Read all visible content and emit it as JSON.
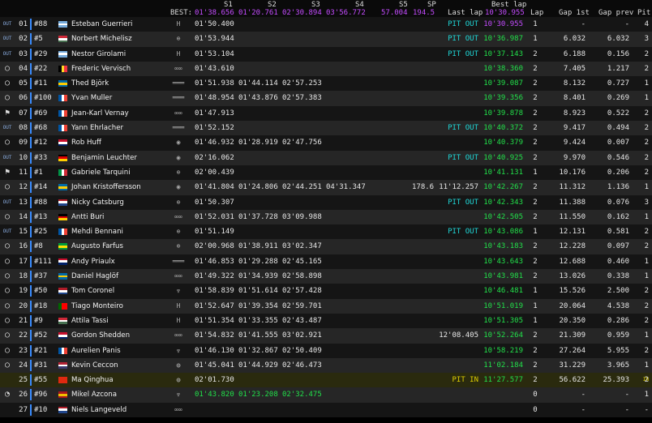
{
  "header": {
    "best_label": "BEST:",
    "s1": "S1",
    "s2": "S2",
    "s3": "S3",
    "s4": "S4",
    "s5": "S5",
    "sp": "SP",
    "best_s1": "01'38.656",
    "best_s2": "01'20.761",
    "best_s3": "02'30.894",
    "best_s4": "03'56.772",
    "best_s5": "57.004",
    "best_sp": "194.5",
    "last_lap": "Last lap",
    "best_lap": "Best lap",
    "best_lap_value": "10'30.955",
    "lap": "Lap",
    "gap1": "Gap 1st",
    "gapprev": "Gap prev",
    "pit": "Pit"
  },
  "colors": {
    "green": "#22e04a",
    "purple": "#c44cff",
    "pitout": "#1fd6d6",
    "pitin": "#e0d000",
    "bar": "#3a8cff"
  },
  "rows": [
    {
      "status": "OUT",
      "pos": "01",
      "num": "#88",
      "flag": "argentina",
      "name": "Esteban Guerrieri",
      "logo": "honda",
      "s1": "01'50.400",
      "s2": "",
      "s3": "",
      "s4": "",
      "s5": "",
      "sp": "",
      "last": "PIT OUT",
      "best": "10'30.955",
      "best_color": "purple",
      "lap": "1",
      "gap1": "-",
      "gapprev": "-",
      "pit": "4"
    },
    {
      "status": "OUT",
      "pos": "02",
      "num": "#5",
      "flag": "hungary",
      "name": "Norbert Michelisz",
      "logo": "hyundai",
      "s1": "01'53.944",
      "s2": "",
      "s3": "",
      "s4": "",
      "s5": "",
      "sp": "",
      "last": "PIT OUT",
      "best": "10'36.987",
      "best_color": "green",
      "lap": "1",
      "gap1": "6.032",
      "gapprev": "6.032",
      "pit": "3"
    },
    {
      "status": "OUT",
      "pos": "03",
      "num": "#29",
      "flag": "argentina",
      "name": "Nestor Girolami",
      "logo": "honda",
      "s1": "01'53.104",
      "s2": "",
      "s3": "",
      "s4": "",
      "s5": "",
      "sp": "",
      "last": "PIT OUT",
      "best": "10'37.143",
      "best_color": "green",
      "lap": "2",
      "gap1": "6.188",
      "gapprev": "0.156",
      "pit": "2"
    },
    {
      "status": "ring",
      "pos": "04",
      "num": "#22",
      "flag": "belgium",
      "name": "Frederic Vervisch",
      "logo": "audi",
      "s1": "01'43.610",
      "s2": "",
      "s3": "",
      "s4": "",
      "s5": "",
      "sp": "",
      "last": "",
      "best": "10'38.360",
      "best_color": "green",
      "lap": "2",
      "gap1": "7.405",
      "gapprev": "1.217",
      "pit": "2"
    },
    {
      "status": "ring",
      "pos": "05",
      "num": "#11",
      "flag": "sweden",
      "name": "Thed Björk",
      "logo": "lynk",
      "s1": "01'51.938",
      "s2": "01'44.114",
      "s3": "02'57.253",
      "s4": "",
      "s5": "",
      "sp": "",
      "last": "",
      "best": "10'39.087",
      "best_color": "green",
      "lap": "2",
      "gap1": "8.132",
      "gapprev": "0.727",
      "pit": "1"
    },
    {
      "status": "ring",
      "pos": "06",
      "num": "#100",
      "flag": "france",
      "name": "Yvan Muller",
      "logo": "lynk",
      "s1": "01'48.954",
      "s2": "01'43.876",
      "s3": "02'57.383",
      "s4": "",
      "s5": "",
      "sp": "",
      "last": "",
      "best": "10'39.356",
      "best_color": "green",
      "lap": "2",
      "gap1": "8.401",
      "gapprev": "0.269",
      "pit": "1"
    },
    {
      "status": "flag",
      "pos": "07",
      "num": "#69",
      "flag": "france",
      "name": "Jean-Karl Vernay",
      "logo": "audi",
      "s1": "01'47.913",
      "s2": "",
      "s3": "",
      "s4": "",
      "s5": "",
      "sp": "",
      "last": "",
      "best": "10'39.878",
      "best_color": "green",
      "lap": "2",
      "gap1": "8.923",
      "gapprev": "0.522",
      "pit": "2"
    },
    {
      "status": "OUT",
      "pos": "08",
      "num": "#68",
      "flag": "france",
      "name": "Yann Ehrlacher",
      "logo": "lynk",
      "s1": "01'52.152",
      "s2": "",
      "s3": "",
      "s4": "",
      "s5": "",
      "sp": "",
      "last": "PIT OUT",
      "best": "10'40.372",
      "best_color": "green",
      "lap": "2",
      "gap1": "9.417",
      "gapprev": "0.494",
      "pit": "2"
    },
    {
      "status": "ring",
      "pos": "09",
      "num": "#12",
      "flag": "uk",
      "name": "Rob Huff",
      "logo": "vw",
      "s1": "01'46.932",
      "s2": "01'28.919",
      "s3": "02'47.756",
      "s4": "",
      "s5": "",
      "sp": "",
      "last": "",
      "best": "10'40.379",
      "best_color": "green",
      "lap": "2",
      "gap1": "9.424",
      "gapprev": "0.007",
      "pit": "2"
    },
    {
      "status": "OUT",
      "pos": "10",
      "num": "#33",
      "flag": "germany",
      "name": "Benjamin Leuchter",
      "logo": "vw",
      "s1": "02'16.062",
      "s2": "",
      "s3": "",
      "s4": "",
      "s5": "",
      "sp": "",
      "last": "PIT OUT",
      "best": "10'40.925",
      "best_color": "green",
      "lap": "2",
      "gap1": "9.970",
      "gapprev": "0.546",
      "pit": "2"
    },
    {
      "status": "flag",
      "pos": "11",
      "num": "#1",
      "flag": "italy",
      "name": "Gabriele Tarquini",
      "logo": "hyundai",
      "s1": "02'00.439",
      "s2": "",
      "s3": "",
      "s4": "",
      "s5": "",
      "sp": "",
      "last": "",
      "best": "10'41.131",
      "best_color": "green",
      "lap": "1",
      "gap1": "10.176",
      "gapprev": "0.206",
      "pit": "2"
    },
    {
      "status": "ring",
      "pos": "12",
      "num": "#14",
      "flag": "sweden",
      "name": "Johan Kristoffersson",
      "logo": "vw",
      "s1": "01'41.804",
      "s2": "01'24.806",
      "s3": "02'44.251",
      "s4": "04'31.347",
      "s5": "",
      "sp": "178.6",
      "last": "11'12.257",
      "best": "10'42.267",
      "best_color": "green",
      "lap": "2",
      "gap1": "11.312",
      "gapprev": "1.136",
      "pit": "1"
    },
    {
      "status": "OUT",
      "pos": "13",
      "num": "#88",
      "flag": "netherlands",
      "name": "Nicky Catsburg",
      "logo": "hyundai",
      "s1": "01'50.307",
      "s2": "",
      "s3": "",
      "s4": "",
      "s5": "",
      "sp": "",
      "last": "PIT OUT",
      "best": "10'42.343",
      "best_color": "green",
      "lap": "2",
      "gap1": "11.388",
      "gapprev": "0.076",
      "pit": "3"
    },
    {
      "status": "ring",
      "pos": "14",
      "num": "#13",
      "flag": "germany",
      "name": "Antti Buri",
      "logo": "audi",
      "s1": "01'52.031",
      "s2": "01'37.728",
      "s3": "03'09.988",
      "s4": "",
      "s5": "",
      "sp": "",
      "last": "",
      "best": "10'42.505",
      "best_color": "green",
      "lap": "2",
      "gap1": "11.550",
      "gapprev": "0.162",
      "pit": "1"
    },
    {
      "status": "OUT",
      "pos": "15",
      "num": "#25",
      "flag": "france",
      "name": "Mehdi Bennani",
      "logo": "hyundai",
      "s1": "01'51.149",
      "s2": "",
      "s3": "",
      "s4": "",
      "s5": "",
      "sp": "",
      "last": "PIT OUT",
      "best": "10'43.086",
      "best_color": "green",
      "lap": "1",
      "gap1": "12.131",
      "gapprev": "0.581",
      "pit": "2"
    },
    {
      "status": "ring",
      "pos": "16",
      "num": "#8",
      "flag": "brazil",
      "name": "Augusto Farfus",
      "logo": "hyundai",
      "s1": "02'00.968",
      "s2": "01'38.911",
      "s3": "03'02.347",
      "s4": "",
      "s5": "",
      "sp": "",
      "last": "",
      "best": "10'43.183",
      "best_color": "green",
      "lap": "2",
      "gap1": "12.228",
      "gapprev": "0.097",
      "pit": "2"
    },
    {
      "status": "ring",
      "pos": "17",
      "num": "#111",
      "flag": "uk",
      "name": "Andy Priaulx",
      "logo": "lynk",
      "s1": "01'46.853",
      "s2": "01'29.288",
      "s3": "02'45.165",
      "s4": "",
      "s5": "",
      "sp": "",
      "last": "",
      "best": "10'43.643",
      "best_color": "green",
      "lap": "2",
      "gap1": "12.688",
      "gapprev": "0.460",
      "pit": "1"
    },
    {
      "status": "ring",
      "pos": "18",
      "num": "#37",
      "flag": "sweden",
      "name": "Daniel Haglöf",
      "logo": "audi",
      "s1": "01'49.322",
      "s2": "01'34.939",
      "s3": "02'58.898",
      "s4": "",
      "s5": "",
      "sp": "",
      "last": "",
      "best": "10'43.981",
      "best_color": "green",
      "lap": "2",
      "gap1": "13.026",
      "gapprev": "0.338",
      "pit": "1"
    },
    {
      "status": "ring",
      "pos": "19",
      "num": "#50",
      "flag": "netherlands",
      "name": "Tom Coronel",
      "logo": "cupra",
      "s1": "01'58.839",
      "s2": "01'51.614",
      "s3": "02'57.428",
      "s4": "",
      "s5": "",
      "sp": "",
      "last": "",
      "best": "10'46.481",
      "best_color": "green",
      "lap": "1",
      "gap1": "15.526",
      "gapprev": "2.500",
      "pit": "2"
    },
    {
      "status": "ring",
      "pos": "20",
      "num": "#18",
      "flag": "portugal",
      "name": "Tiago Monteiro",
      "logo": "honda",
      "s1": "01'52.647",
      "s2": "01'39.354",
      "s3": "02'59.701",
      "s4": "",
      "s5": "",
      "sp": "",
      "last": "",
      "best": "10'51.019",
      "best_color": "green",
      "lap": "1",
      "gap1": "20.064",
      "gapprev": "4.538",
      "pit": "2"
    },
    {
      "status": "ring",
      "pos": "21",
      "num": "#9",
      "flag": "hungary",
      "name": "Attila Tassi",
      "logo": "honda",
      "s1": "01'51.354",
      "s2": "01'33.355",
      "s3": "02'43.487",
      "s4": "",
      "s5": "",
      "sp": "",
      "last": "",
      "best": "10'51.305",
      "best_color": "green",
      "lap": "1",
      "gap1": "20.350",
      "gapprev": "0.286",
      "pit": "2"
    },
    {
      "status": "ring",
      "pos": "22",
      "num": "#52",
      "flag": "uk",
      "name": "Gordon Shedden",
      "logo": "audi",
      "s1": "01'54.832",
      "s2": "01'41.555",
      "s3": "03'02.921",
      "s4": "",
      "s5": "",
      "sp": "",
      "last": "12'08.405",
      "best": "10'52.264",
      "best_color": "green",
      "lap": "2",
      "gap1": "21.309",
      "gapprev": "0.959",
      "pit": "1"
    },
    {
      "status": "ring",
      "pos": "23",
      "num": "#21",
      "flag": "france",
      "name": "Aurelien Panis",
      "logo": "cupra",
      "s1": "01'46.130",
      "s2": "01'32.867",
      "s3": "02'50.409",
      "s4": "",
      "s5": "",
      "sp": "",
      "last": "",
      "best": "10'58.219",
      "best_color": "green",
      "lap": "2",
      "gap1": "27.264",
      "gapprev": "5.955",
      "pit": "2"
    },
    {
      "status": "ring",
      "pos": "24",
      "num": "#31",
      "flag": "usa",
      "name": "Kevin Ceccon",
      "logo": "alfa",
      "s1": "01'45.041",
      "s2": "01'44.929",
      "s3": "02'46.473",
      "s4": "",
      "s5": "",
      "sp": "",
      "last": "",
      "best": "11'02.184",
      "best_color": "green",
      "lap": "2",
      "gap1": "31.229",
      "gapprev": "3.965",
      "pit": "1"
    },
    {
      "status": "IN",
      "pos": "25",
      "num": "#55",
      "flag": "china",
      "name": "Ma Qinghua",
      "logo": "alfa",
      "s1": "02'01.730",
      "s2": "",
      "s3": "",
      "s4": "",
      "s5": "",
      "sp": "",
      "last": "PIT IN",
      "best": "11'27.577",
      "best_color": "green",
      "lap": "2",
      "gap1": "56.622",
      "gapprev": "25.393",
      "pit": "2"
    },
    {
      "status": "clock",
      "pos": "26",
      "num": "#96",
      "flag": "spain",
      "name": "Mikel Azcona",
      "logo": "cupra",
      "s1": "01'43.820",
      "s2": "01'23.208",
      "s3": "02'32.475",
      "s4": "",
      "s5": "",
      "sp": "",
      "last": "",
      "best": "",
      "best_color": "green",
      "lap": "0",
      "gap1": "-",
      "gapprev": "-",
      "pit": "1",
      "green_sectors": true
    },
    {
      "status": "none",
      "pos": "27",
      "num": "#10",
      "flag": "netherlands",
      "name": "Niels Langeveld",
      "logo": "audi",
      "s1": "",
      "s2": "",
      "s3": "",
      "s4": "",
      "s5": "",
      "sp": "",
      "last": "",
      "best": "",
      "best_color": "green",
      "lap": "0",
      "gap1": "-",
      "gapprev": "-",
      "pit": "-"
    }
  ]
}
